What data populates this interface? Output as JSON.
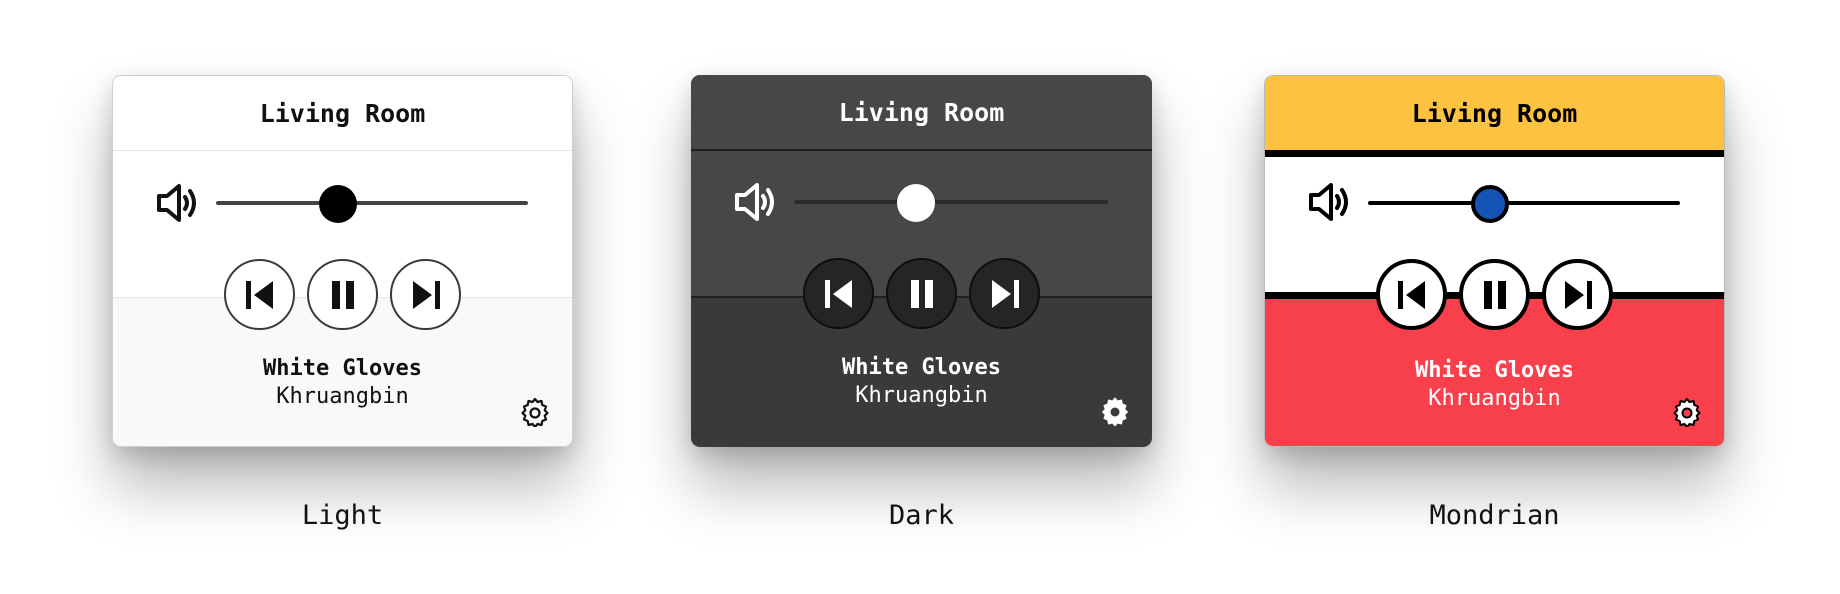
{
  "panels": [
    {
      "theme": "light",
      "room": "Living Room",
      "track_title": "White Gloves",
      "artist": "Khruangbin",
      "volume": 0.39,
      "caption": "Light",
      "colors": {
        "header": "#ffffff",
        "body": "#f9f9f9",
        "text": "#111111",
        "knob": "#000000",
        "track": "#444444"
      }
    },
    {
      "theme": "dark",
      "room": "Living Room",
      "track_title": "White Gloves",
      "artist": "Khruangbin",
      "volume": 0.39,
      "caption": "Dark",
      "colors": {
        "header": "#474747",
        "body": "#3a3a3a",
        "text": "#ffffff",
        "knob": "#ffffff",
        "track": "#2b2b2b"
      }
    },
    {
      "theme": "mondrian",
      "room": "Living Room",
      "track_title": "White Gloves",
      "artist": "Khruangbin",
      "volume": 0.39,
      "caption": "Mondrian",
      "colors": {
        "header": "#fcc240",
        "middle": "#ffffff",
        "body": "#f8404d",
        "text": "#000000",
        "knob": "#1553b6",
        "track": "#000000"
      }
    }
  ],
  "icons": [
    "speaker-icon",
    "previous-icon",
    "pause-icon",
    "next-icon",
    "gear-icon"
  ]
}
